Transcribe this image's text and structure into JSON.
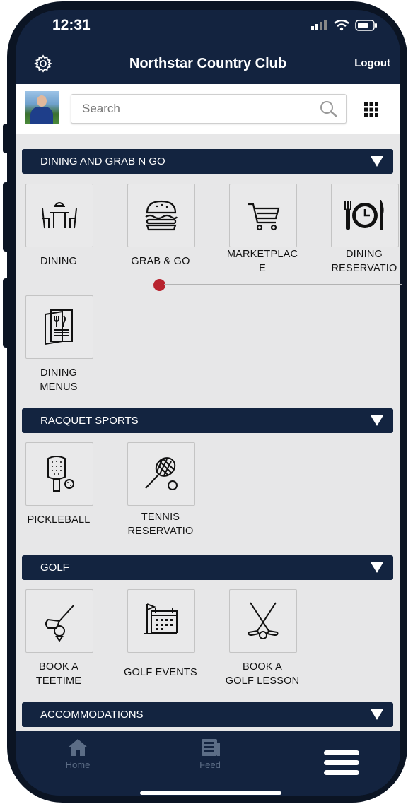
{
  "status": {
    "time": "12:31"
  },
  "header": {
    "title": "Northstar Country Club",
    "logout_label": "Logout"
  },
  "search": {
    "placeholder": "Search"
  },
  "sections": [
    {
      "title": "DINING AND GRAB N GO",
      "items": [
        {
          "label": "DINING",
          "icon": "dining-table-icon"
        },
        {
          "label": "GRAB & GO",
          "icon": "burger-icon"
        },
        {
          "label": "MARKETPLAC\nE",
          "icon": "shopping-cart-icon"
        },
        {
          "label": "DINING\nRESERVATIO",
          "icon": "plate-clock-icon"
        },
        {
          "label": "DINING\nMENUS",
          "icon": "menu-book-icon"
        }
      ]
    },
    {
      "title": "RACQUET SPORTS",
      "items": [
        {
          "label": "PICKLEBALL",
          "icon": "pickleball-paddle-icon"
        },
        {
          "label": "TENNIS\nRESERVATIO",
          "icon": "tennis-racquet-icon"
        }
      ]
    },
    {
      "title": "GOLF",
      "items": [
        {
          "label": "BOOK A\nTEETIME",
          "icon": "golf-tee-icon"
        },
        {
          "label": "GOLF EVENTS",
          "icon": "golf-calendar-icon"
        },
        {
          "label": "BOOK A\nGOLF LESSON",
          "icon": "golf-clubs-icon"
        }
      ]
    },
    {
      "title": "ACCOMMODATIONS",
      "items": []
    }
  ],
  "tabbar": {
    "home_label": "Home",
    "feed_label": "Feed"
  },
  "colors": {
    "navy": "#132440",
    "background": "#e7e7e8",
    "marker": "#b8232e"
  }
}
